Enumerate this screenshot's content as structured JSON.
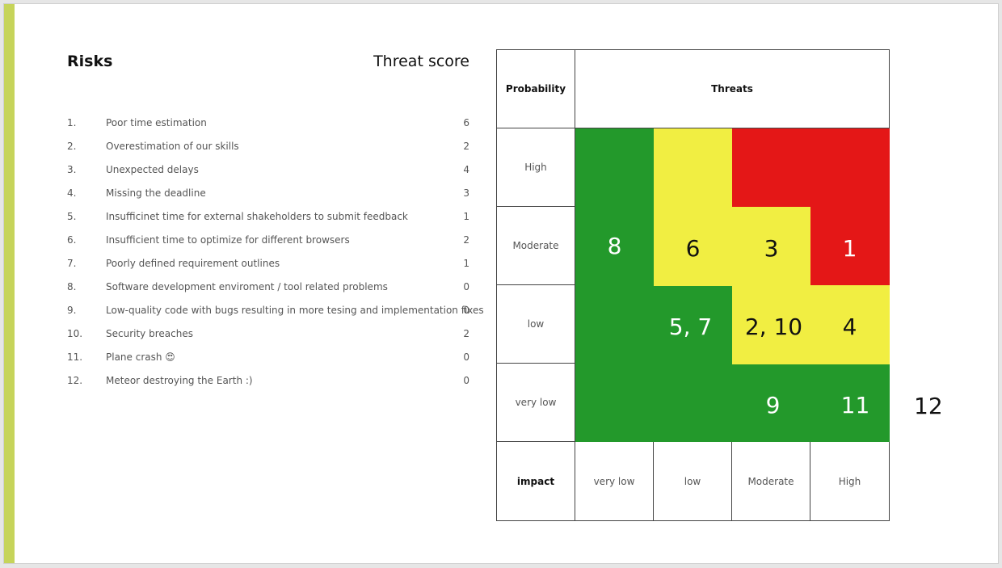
{
  "headings": {
    "risks": "Risks",
    "threat_score": "Threat score"
  },
  "risks": [
    {
      "num": "1.",
      "label": "Poor time estimation",
      "score": "6"
    },
    {
      "num": "2.",
      "label": "Overestimation of our skills",
      "score": "2"
    },
    {
      "num": "3.",
      "label": "Unexpected delays",
      "score": "4"
    },
    {
      "num": "4.",
      "label": "Missing the deadline",
      "score": "3"
    },
    {
      "num": "5.",
      "label": "Insufficinet time for external shakeholders to submit feedback",
      "score": "1"
    },
    {
      "num": "6.",
      "label": "Insufficient time to optimize for different browsers",
      "score": "2"
    },
    {
      "num": "7.",
      "label": "Poorly defined requirement outlines",
      "score": "1"
    },
    {
      "num": "8.",
      "label": "Software development enviroment / tool related problems",
      "score": "0"
    },
    {
      "num": "9.",
      "label": "Low-quality code with bugs resulting in more tesing and implementation fixes",
      "score": "0"
    },
    {
      "num": "10.",
      "label": "Security breaches",
      "score": "2"
    },
    {
      "num": "11.",
      "label": "Plane crash 😍",
      "score": "0"
    },
    {
      "num": "12.",
      "label": "Meteor destroying the Earth :)",
      "score": "0"
    }
  ],
  "matrix": {
    "probability_header": "Probability",
    "threats_header": "Threats",
    "impact_header": "impact",
    "probability_levels": [
      "High",
      "Moderate",
      "low",
      "very low"
    ],
    "impact_levels": [
      "very low",
      "low",
      "Moderate",
      "High"
    ],
    "cell_numbers": {
      "c8": "8",
      "c6": "6",
      "c3": "3",
      "c1": "1",
      "c57": "5, 7",
      "c210": "2, 10",
      "c4": "4",
      "c9": "9",
      "c11": "11"
    },
    "outside": "12",
    "colors": {
      "green": "#23992b",
      "yellow": "#f1ee42",
      "red": "#e41717"
    }
  }
}
